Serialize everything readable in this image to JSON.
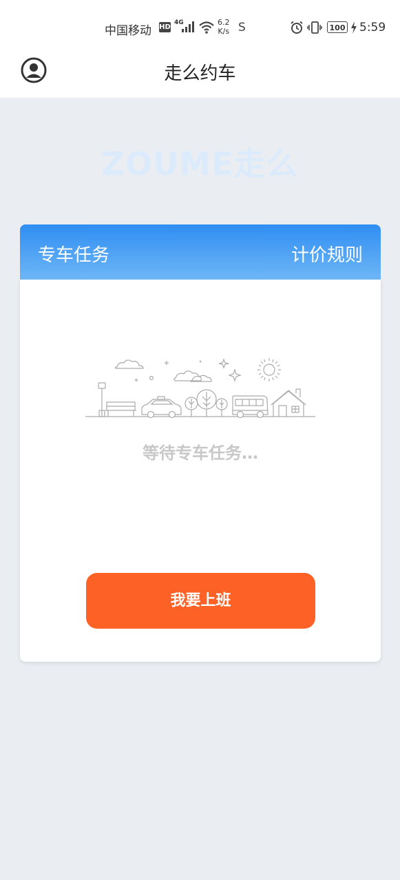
{
  "status_bar": {
    "carrier": "中国移动",
    "hd_badge": "HD",
    "network": "4G",
    "speed_value": "6.2",
    "speed_unit": "K/s",
    "sync_glyph": "S",
    "battery": "100",
    "time": "5:59",
    "icons": [
      "signal-icon",
      "wifi-icon",
      "alarm-icon",
      "vibrate-icon",
      "battery-icon",
      "charging-icon"
    ]
  },
  "header": {
    "title": "走么约车",
    "user_icon": "user-circle-icon"
  },
  "logo": {
    "text": "ZOUME走么",
    "color": "#dcebfb"
  },
  "tabs": {
    "left_label": "专车任务",
    "right_label": "计价规则",
    "gradient_top": "#2f8ef2",
    "gradient_bottom": "#6eb6f6"
  },
  "main": {
    "illustration": "city-street-illustration",
    "waiting_text": "等待专车任务…",
    "button_label": "我要上班",
    "button_color": "#fe6125"
  }
}
